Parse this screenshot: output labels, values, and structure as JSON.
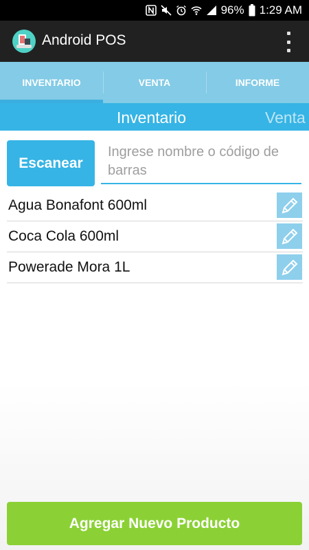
{
  "status_bar": {
    "battery": "96%",
    "time": "1:29 AM",
    "icons": [
      "nfc-icon",
      "mute-icon",
      "alarm-icon",
      "wifi-icon",
      "signal-icon",
      "battery-icon"
    ]
  },
  "action_bar": {
    "title": "Android POS",
    "app_icon": "pos-app-icon",
    "menu_icon": "overflow-menu-icon"
  },
  "tabs": [
    {
      "label": "INVENTARIO",
      "active": true
    },
    {
      "label": "VENTA",
      "active": false
    },
    {
      "label": "INFORME",
      "active": false
    }
  ],
  "pager": {
    "current": "Inventario",
    "next": "Venta"
  },
  "search": {
    "scan_label": "Escanear",
    "placeholder": "Ingrese nombre o código de barras"
  },
  "products": [
    {
      "name": "Agua Bonafont 600ml"
    },
    {
      "name": "Coca Cola 600ml"
    },
    {
      "name": "Powerade Mora 1L"
    }
  ],
  "add_button": {
    "label": "Agregar Nuevo Producto"
  },
  "colors": {
    "accent": "#36b4e5",
    "tabs_bg": "#83cbe6",
    "add_green": "#8bd135",
    "action_bar": "#212121"
  }
}
